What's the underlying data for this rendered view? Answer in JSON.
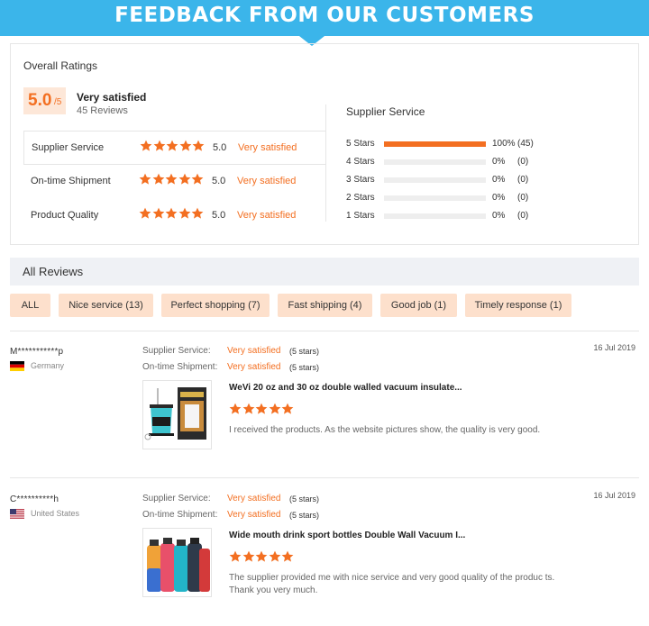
{
  "banner": {
    "title": "FEEDBACK FROM OUR CUSTOMERS"
  },
  "overall": {
    "title": "Overall Ratings",
    "score": "5.0",
    "score_suffix": "/5",
    "label": "Very satisfied",
    "reviews": "45 Reviews",
    "rows": [
      {
        "label": "Supplier Service",
        "score": "5.0",
        "verdict": "Very satisfied",
        "stars": 5
      },
      {
        "label": "On-time Shipment",
        "score": "5.0",
        "verdict": "Very satisfied",
        "stars": 5
      },
      {
        "label": "Product Quality",
        "score": "5.0",
        "verdict": "Very satisfied",
        "stars": 5
      }
    ]
  },
  "distribution": {
    "title": "Supplier Service",
    "rows": [
      {
        "label": "5 Stars",
        "fraction": 1.0,
        "pct": "100%",
        "count": "(45)"
      },
      {
        "label": "4 Stars",
        "fraction": 0,
        "pct": "0%",
        "count": "(0)"
      },
      {
        "label": "3 Stars",
        "fraction": 0,
        "pct": "0%",
        "count": "(0)"
      },
      {
        "label": "2 Stars",
        "fraction": 0,
        "pct": "0%",
        "count": "(0)"
      },
      {
        "label": "1 Stars",
        "fraction": 0,
        "pct": "0%",
        "count": "(0)"
      }
    ]
  },
  "all_reviews": {
    "title": "All Reviews",
    "filters": [
      "ALL",
      "Nice service (13)",
      "Perfect shopping (7)",
      "Fast shipping (4)",
      "Good job (1)",
      "Timely response (1)"
    ]
  },
  "reviews": [
    {
      "user": "M***********p",
      "country": "Germany",
      "flag": "germany-flag",
      "date": "16 Jul 2019",
      "service_label": "Supplier Service:",
      "service_value": "Very satisfied",
      "service_stars": "(5 stars)",
      "shipment_label": "On-time Shipment:",
      "shipment_value": "Very satisfied",
      "shipment_stars": "(5 stars)",
      "product": "WeVi 20 oz and 30 oz double walled vacuum insulate...",
      "rating": 5,
      "text": "I received the products. As the website pictures show, the quality is very good."
    },
    {
      "user": "C**********h",
      "country": "United States",
      "flag": "usa-flag",
      "date": "16 Jul 2019",
      "service_label": "Supplier Service:",
      "service_value": "Very satisfied",
      "service_stars": "(5 stars)",
      "shipment_label": "On-time Shipment:",
      "shipment_value": "Very satisfied",
      "shipment_stars": "(5 stars)",
      "product": "Wide mouth drink sport bottles Double Wall Vacuum I...",
      "rating": 5,
      "text": "The supplier provided me with nice service and very good quality of the produc ts. Thank you very much."
    }
  ],
  "colors": {
    "accent": "#f36f21",
    "banner": "#3bb5ea",
    "chip": "#fde0cc",
    "bar_bg": "#eeeeee"
  }
}
